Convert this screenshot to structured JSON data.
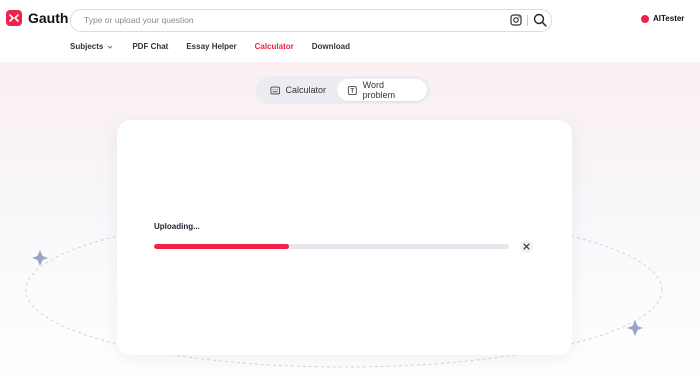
{
  "brand": {
    "name": "Gauth",
    "color": "#f0224a"
  },
  "search": {
    "placeholder": "Type or upload your question"
  },
  "user": {
    "name": "AITester"
  },
  "nav": {
    "items": [
      {
        "label": "Subjects",
        "has_dropdown": true,
        "active": false
      },
      {
        "label": "PDF Chat",
        "active": false
      },
      {
        "label": "Essay Helper",
        "active": false
      },
      {
        "label": "Calculator",
        "active": true
      },
      {
        "label": "Download",
        "active": false
      }
    ]
  },
  "mode_toggle": {
    "calculator_label": "Calculator",
    "word_problem_label": "Word problem",
    "selected": "Word problem"
  },
  "upload": {
    "status_label": "Uploading...",
    "progress": 0.38
  }
}
